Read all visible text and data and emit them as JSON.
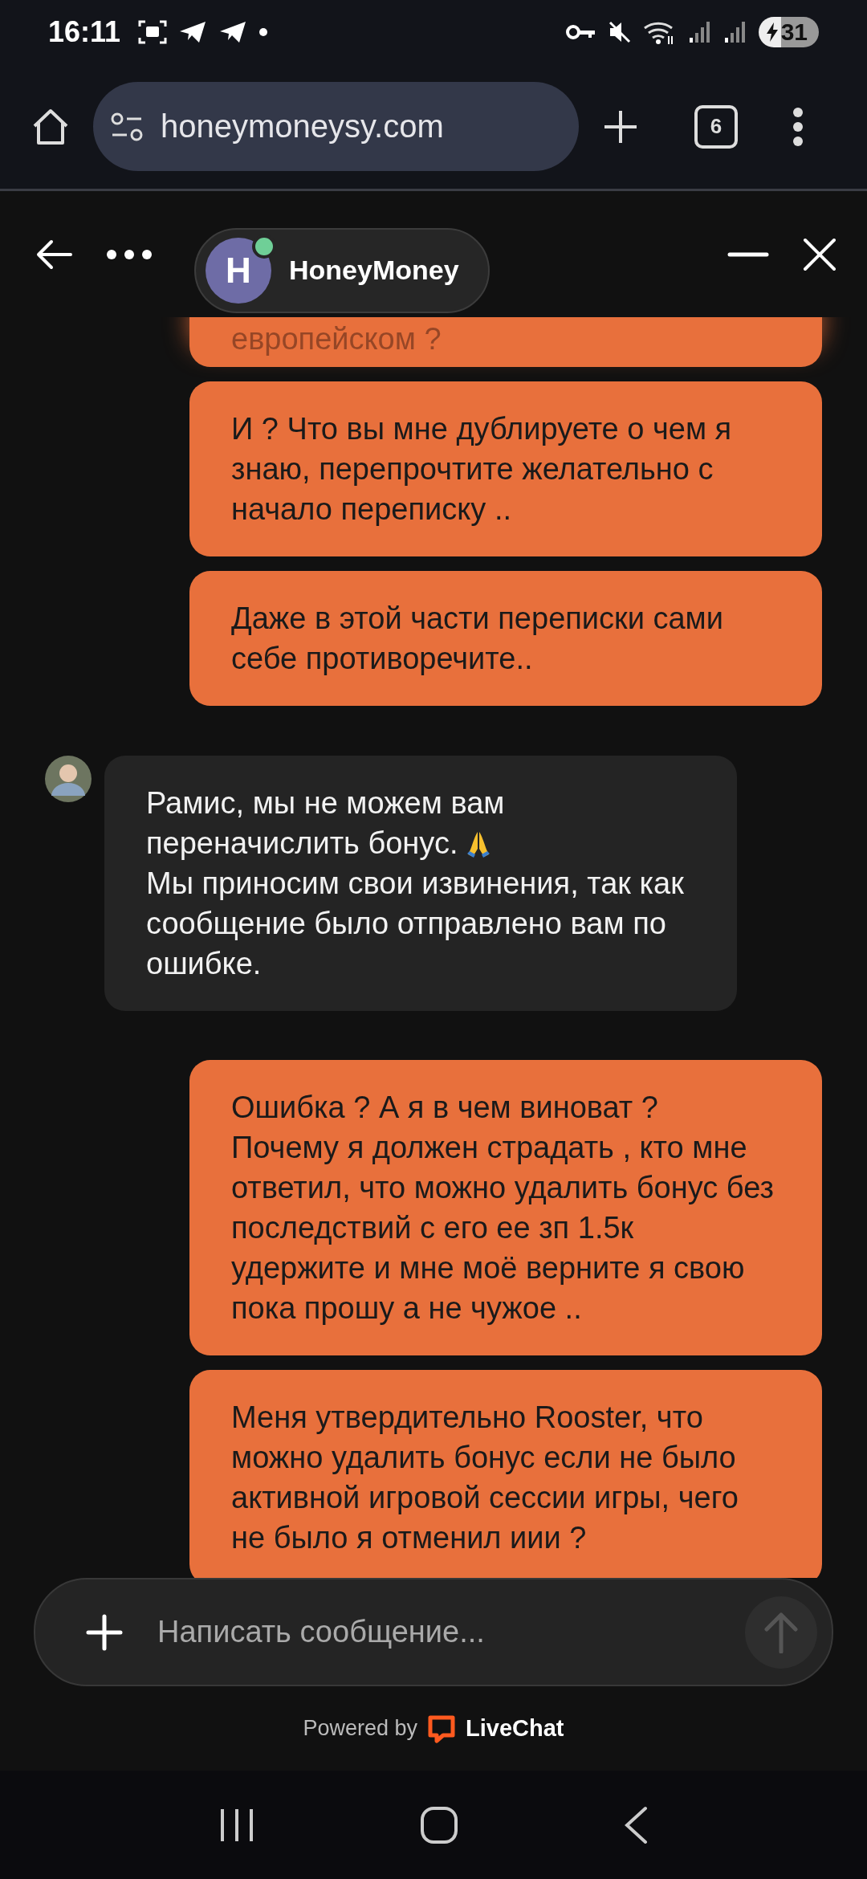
{
  "status_bar": {
    "time": "16:11",
    "battery": "31"
  },
  "browser": {
    "url": "honeymoneysy.com",
    "tab_count": "6"
  },
  "chat_header": {
    "title": "HoneyMoney",
    "avatar_letter": "H",
    "online": true
  },
  "messages": [
    {
      "kind": "user",
      "paragraphs": [
        "европейском ?"
      ]
    },
    {
      "kind": "user",
      "paragraphs": [
        "И ? Что вы мне дублируете о чем я знаю, перепрочтите желательно с начало переписку .."
      ]
    },
    {
      "kind": "user",
      "paragraphs": [
        "Даже в этой части переписки сами себе противоречите.."
      ]
    },
    {
      "kind": "agent",
      "paragraphs": [
        "Рамис, мы не можем вам переначислить бонус.",
        "Мы приносим свои извинения, так как сообщение было отправлено вам по ошибке."
      ],
      "emoji_icon": true
    },
    {
      "kind": "user",
      "paragraphs": [
        "Ошибка ? А я в чем виноват ? Почему я должен страдать , кто мне ответил, что можно удалить бонус без последствий с его ее зп 1.5к удержите и мне моё верните я свою пока прошу а не чужое .."
      ]
    },
    {
      "kind": "user",
      "paragraphs": [
        "Меня утвердительно Rooster, что можно удалить бонус если не было активной игровой сессии игры, чего не было я отменил иии ?"
      ]
    }
  ],
  "composer": {
    "placeholder": "Написать сообщение..."
  },
  "footer": {
    "powered_by": "Powered by",
    "brand": "LiveChat"
  }
}
